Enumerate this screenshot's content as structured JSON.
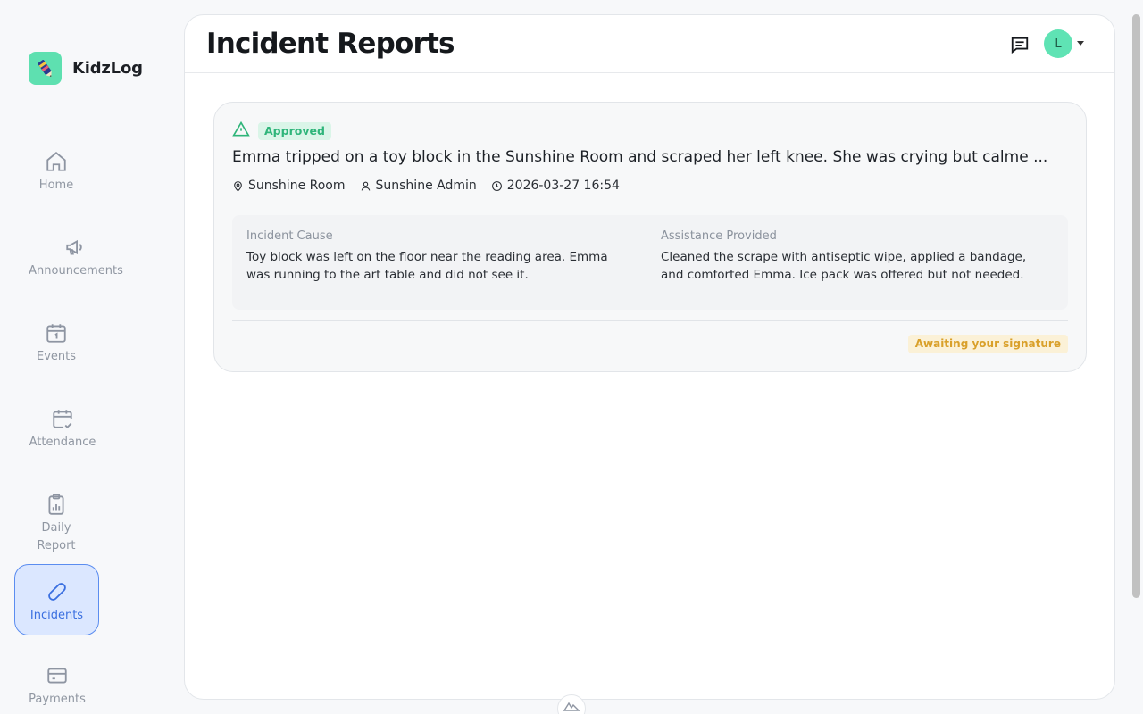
{
  "app": {
    "name": "KidzLog"
  },
  "sidebar": {
    "items": [
      {
        "label": "Home",
        "icon": "home-icon"
      },
      {
        "label": "Announcements",
        "icon": "megaphone-icon"
      },
      {
        "label": "Events",
        "icon": "calendar-icon"
      },
      {
        "label": "Attendance",
        "icon": "calendar-check-icon"
      },
      {
        "label": "Daily Report",
        "icon": "clipboard-chart-icon"
      },
      {
        "label": "Incidents",
        "icon": "bandage-icon",
        "active": true
      },
      {
        "label": "Payments",
        "icon": "credit-card-icon"
      }
    ]
  },
  "header": {
    "title": "Incident Reports",
    "avatar_initial": "L"
  },
  "incident": {
    "status": "Approved",
    "summary": "Emma tripped on a toy block in the Sunshine Room and scraped her left knee. She was crying but calme ...",
    "location": "Sunshine Room",
    "reporter": "Sunshine Admin",
    "datetime": "2026-03-27 16:54",
    "cause_label": "Incident Cause",
    "cause_text": "Toy block was left on the floor near the reading area. Emma was running to the art table and did not see it.",
    "assistance_label": "Assistance Provided",
    "assistance_text": "Cleaned the scrape with antiseptic wipe, applied a bandage, and comforted Emma. Ice pack was offered but not needed.",
    "signature_status": "Awaiting your signature"
  },
  "colors": {
    "accent": "#3a6fe0",
    "brand": "#5ee0b0",
    "approved": "#2fb57a",
    "pending": "#d9a02a"
  }
}
